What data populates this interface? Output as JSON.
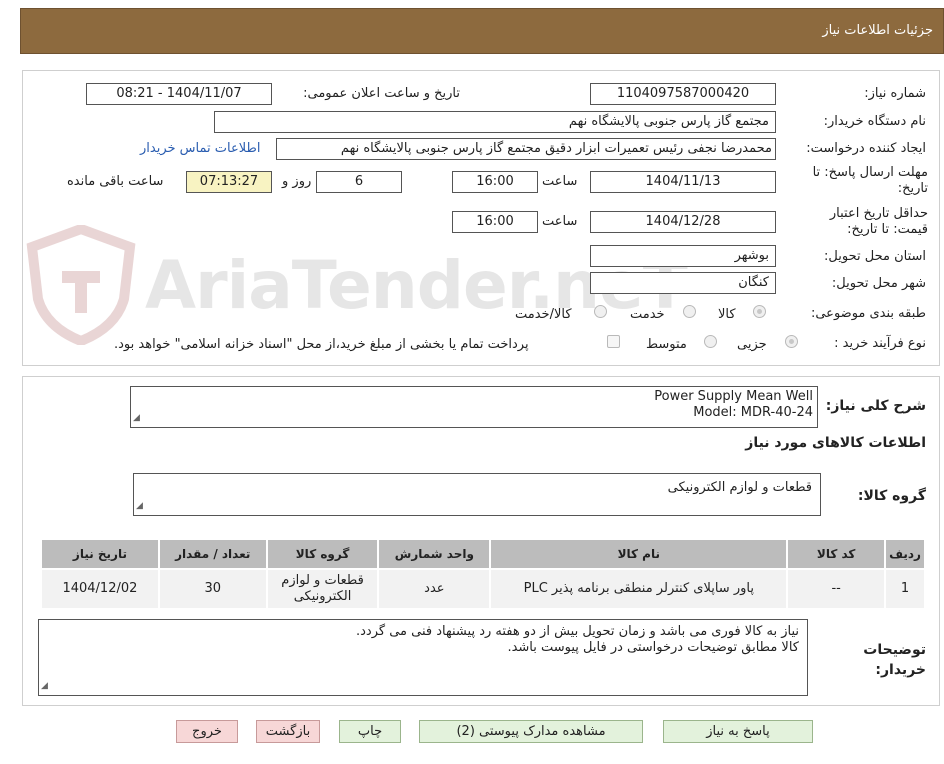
{
  "header": {
    "title": "جزئیات اطلاعات نیاز"
  },
  "fields": {
    "need_number_label": "شماره نیاز:",
    "need_number": "1104097587000420",
    "announce_label": "تاریخ و ساعت اعلان عمومی:",
    "announce_value": "1404/11/07 - 08:21",
    "buyer_org_label": "نام دستگاه خریدار:",
    "buyer_org": "مجتمع گاز پارس جنوبی  پالایشگاه نهم",
    "requester_label": "ایجاد کننده درخواست:",
    "requester": "محمدرضا نجفی رئیس تعمیرات ابزار دقیق مجتمع گاز پارس جنوبی  پالایشگاه نهم",
    "contact_link": "اطلاعات تماس خریدار",
    "deadline_label": "مهلت ارسال پاسخ: تا تاریخ:",
    "deadline_date": "1404/11/13",
    "time_label": "ساعت",
    "deadline_time": "16:00",
    "days_value": "6",
    "days_label": "روز و",
    "remaining_time": "07:13:27",
    "remaining_label": "ساعت باقی مانده",
    "validity_label": "حداقل تاریخ اعتبار قیمت: تا تاریخ:",
    "validity_date": "1404/12/28",
    "validity_time": "16:00",
    "province_label": "استان محل تحویل:",
    "province": "بوشهر",
    "city_label": "شهر محل تحویل:",
    "city": "کنگان",
    "category_label": "طبقه بندی موضوعی:",
    "category_options": [
      "کالا",
      "خدمت",
      "کالا/خدمت"
    ],
    "process_label": "نوع فرآیند خرید :",
    "process_options": [
      "جزیی",
      "متوسط"
    ],
    "payment_note": "پرداخت تمام یا بخشی از مبلغ خرید،از محل \"اسناد خزانه اسلامی\" خواهد بود."
  },
  "watermark": {
    "text": "AriaTender.neT"
  },
  "summary": {
    "label": "شرح کلی نیاز:",
    "line1": "Power Supply Mean Well",
    "line2": "Model: MDR-40-24"
  },
  "goods_section": {
    "title": "اطلاعات کالاهای مورد نیاز",
    "group_label": "گروه کالا:",
    "group_value": "قطعات و لوازم الکترونیکی"
  },
  "table": {
    "headers": [
      "ردیف",
      "کد کالا",
      "نام کالا",
      "واحد شمارش",
      "گروه کالا",
      "تعداد / مقدار",
      "تاریخ نیاز"
    ],
    "rows": [
      {
        "row": "1",
        "code": "--",
        "name": "پاور ساپلای کنترلر منطقی برنامه پذیر PLC",
        "unit": "عدد",
        "group": "قطعات و لوازم الکترونیکی",
        "qty": "30",
        "date": "1404/12/02"
      }
    ]
  },
  "buyer_notes": {
    "label": "توضیحات خریدار:",
    "line1": "نیاز به کالا فوری می باشد و زمان تحویل بیش از دو هفته رد پیشنهاد فنی می گردد.",
    "line2": "کالا مطابق توضیحات درخواستی در فایل پیوست باشد."
  },
  "buttons": {
    "reply": "پاسخ به نیاز",
    "attachments": "مشاهده مدارک پیوستی (2)",
    "print": "چاپ",
    "back": "بازگشت",
    "exit": "خروج"
  },
  "colors": {
    "header_bg": "#8d6a3e",
    "link": "#2a5db0",
    "table_header_bg": "#bcbcbc",
    "remaining_bg": "#f8f3c2"
  }
}
